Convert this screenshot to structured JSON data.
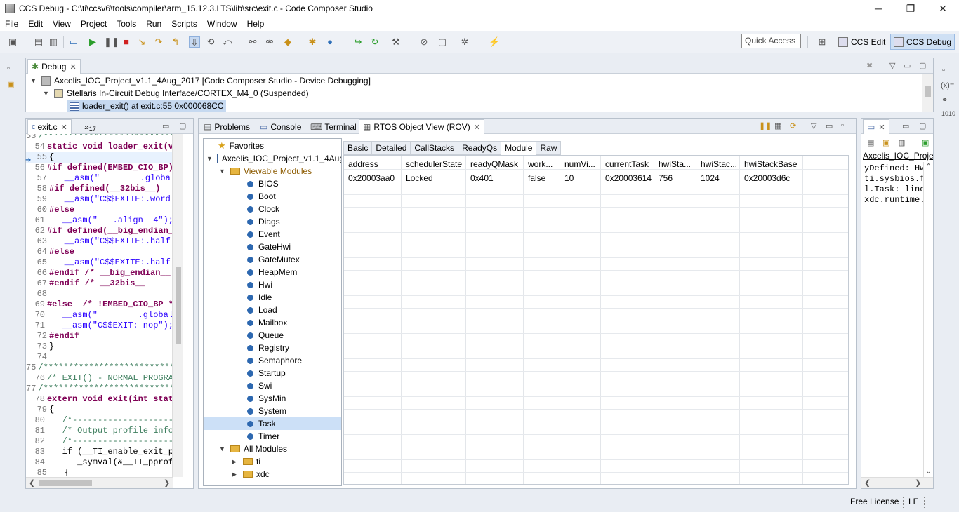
{
  "window": {
    "title": "CCS Debug - C:\\ti\\ccsv6\\tools\\compiler\\arm_15.12.3.LTS\\lib\\src\\exit.c - Code Composer Studio",
    "min": "─",
    "max": "❐",
    "close": "✕"
  },
  "menu": [
    "File",
    "Edit",
    "View",
    "Project",
    "Tools",
    "Run",
    "Scripts",
    "Window",
    "Help"
  ],
  "toolbar": {
    "quick_access": "Quick Access",
    "perspectives": [
      {
        "label": "CCS Edit"
      },
      {
        "label": "CCS Debug"
      }
    ]
  },
  "debug_view": {
    "tab_label": "Debug",
    "rows": [
      "Axcelis_IOC_Project_v1.1_4Aug_2017 [Code Composer Studio - Device Debugging]",
      "Stellaris In-Circuit Debug Interface/CORTEX_M4_0 (Suspended)",
      "loader_exit() at exit.c:55 0x000068CC"
    ]
  },
  "editor": {
    "tab_label": "exit.c",
    "overflow_label": "»",
    "overflow_count": "17",
    "lines": [
      {
        "n": "53",
        "t": "/****************************"
      },
      {
        "n": "54",
        "t": "static void loader_exit(v"
      },
      {
        "n": "55",
        "t": "{"
      },
      {
        "n": "56",
        "t": "#if defined(EMBED_CIO_BP)"
      },
      {
        "n": "57",
        "t": "   __asm(\"        .globa"
      },
      {
        "n": "58",
        "t": "#if defined(__32bis__)"
      },
      {
        "n": "59",
        "t": "   __asm(\"C$$EXITE:.word"
      },
      {
        "n": "60",
        "t": "#else"
      },
      {
        "n": "61",
        "t": "   __asm(\"   .align  4\");"
      },
      {
        "n": "62",
        "t": "#if defined(__big_endian_"
      },
      {
        "n": "63",
        "t": "   __asm(\"C$$EXITE:.half"
      },
      {
        "n": "64",
        "t": "#else"
      },
      {
        "n": "65",
        "t": "   __asm(\"C$$EXITE:.half"
      },
      {
        "n": "66",
        "t": "#endif /* __big_endian__"
      },
      {
        "n": "67",
        "t": "#endif /* __32bis__"
      },
      {
        "n": "68",
        "t": ""
      },
      {
        "n": "69",
        "t": "#else  /* !EMBED_CIO_BP *"
      },
      {
        "n": "70",
        "t": "   __asm(\"        .global"
      },
      {
        "n": "71",
        "t": "   __asm(\"C$$EXIT: nop\");"
      },
      {
        "n": "72",
        "t": "#endif"
      },
      {
        "n": "73",
        "t": "}"
      },
      {
        "n": "74",
        "t": ""
      },
      {
        "n": "75",
        "t": "/****************************"
      },
      {
        "n": "76",
        "t": "/* EXIT() - NORMAL PROGRA"
      },
      {
        "n": "77",
        "t": "/****************************"
      },
      {
        "n": "78",
        "t": "extern void exit(int stat"
      },
      {
        "n": "79",
        "t": "{"
      },
      {
        "n": "80",
        "t": "   /*--------------------"
      },
      {
        "n": "81",
        "t": "   /* Output profile info"
      },
      {
        "n": "82",
        "t": "   /*--------------------"
      },
      {
        "n": "83",
        "t": "   if (__TI_enable_exit_p"
      },
      {
        "n": "84",
        "t": "      _symval(&__TI_pprof"
      },
      {
        "n": "85",
        "t": "   {"
      }
    ]
  },
  "bottom_tabs": {
    "problems": "Problems",
    "console": "Console",
    "terminal": "Terminal",
    "rov": "RTOS Object View (ROV)"
  },
  "rov": {
    "tree": {
      "favorites": "Favorites",
      "project": "Axcelis_IOC_Project_v1.1_4Aug",
      "viewable_modules": "Viewable Modules",
      "modules": [
        "BIOS",
        "Boot",
        "Clock",
        "Diags",
        "Event",
        "GateHwi",
        "GateMutex",
        "HeapMem",
        "Hwi",
        "Idle",
        "Load",
        "Mailbox",
        "Queue",
        "Registry",
        "Semaphore",
        "Startup",
        "Swi",
        "SysMin",
        "System",
        "Task",
        "Timer"
      ],
      "selected": "Task",
      "all_modules": "All Modules",
      "all_children": [
        "ti",
        "xdc"
      ]
    },
    "tabs": [
      "Basic",
      "Detailed",
      "CallStacks",
      "ReadyQs",
      "Module",
      "Raw"
    ],
    "active_tab": "Module",
    "columns": [
      "address",
      "schedulerState",
      "readyQMask",
      "work...",
      "numVi...",
      "currentTask",
      "hwiSta...",
      "hwiStac...",
      "hwiStackBase"
    ],
    "rows": [
      [
        "0x20003aa0",
        "Locked",
        "0x401",
        "false",
        "10",
        "0x20003614",
        "756",
        "1024",
        "0x20003d6c"
      ]
    ]
  },
  "outline": {
    "header": "Axcelis_IOC_Project",
    "lines": [
      "yDefined: Hw",
      "ti.sysbios.f",
      "l.Task: line",
      "xdc.runtime."
    ]
  },
  "status": {
    "license": "Free License",
    "mode": "LE"
  }
}
